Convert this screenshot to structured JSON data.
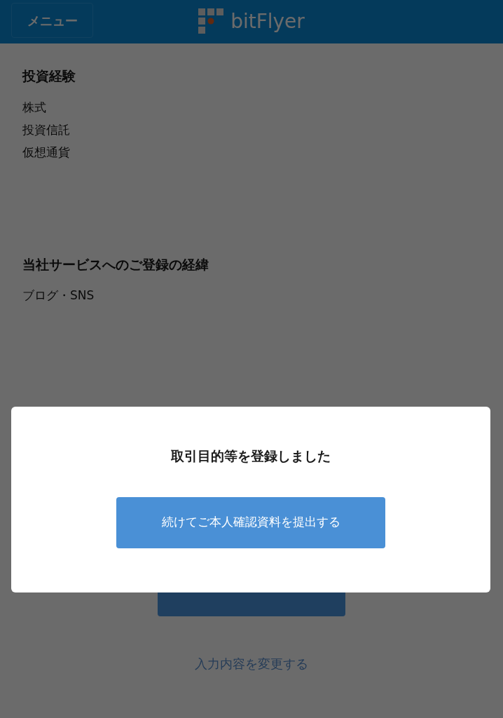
{
  "header": {
    "menu_button": "メニュー",
    "logo_text": "bitFlyer"
  },
  "sections": [
    {
      "heading": "投資経験",
      "items": [
        "株式",
        "投資信託",
        "仮想通貨"
      ]
    },
    {
      "heading": "当社サービスへのご登録の経緯",
      "items": [
        "ブログ・SNS"
      ]
    }
  ],
  "change_link": "入力内容を変更する",
  "modal": {
    "message": "取引目的等を登録しました",
    "button": "続けてご本人確認資料を提出する"
  }
}
